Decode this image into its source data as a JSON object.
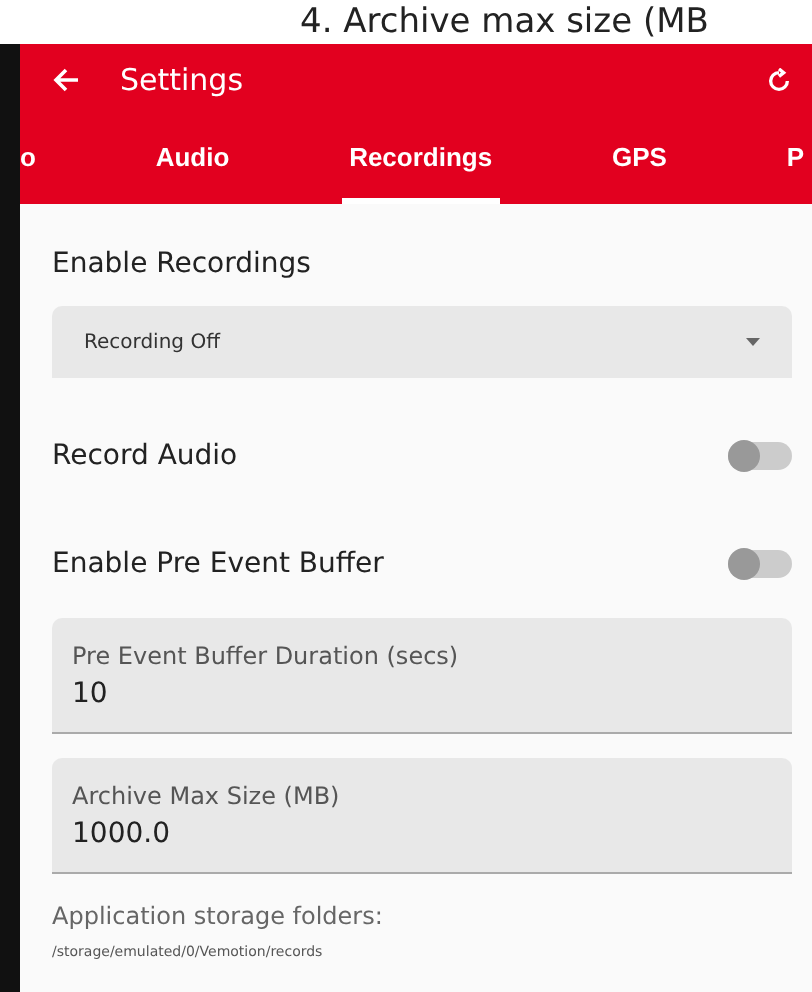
{
  "caption": "4.  Archive max size (MB",
  "app_bar": {
    "title": "Settings"
  },
  "tabs": [
    {
      "label": "o",
      "selected": false
    },
    {
      "label": "Audio",
      "selected": false
    },
    {
      "label": "Recordings",
      "selected": true
    },
    {
      "label": "GPS",
      "selected": false
    },
    {
      "label": "P",
      "selected": false
    }
  ],
  "settings": [
    {
      "kind": "header",
      "label": "Enable Recordings"
    },
    {
      "kind": "dropdown",
      "value": "Recording Off"
    },
    {
      "kind": "switch",
      "label": "Record Audio",
      "on": false
    },
    {
      "kind": "switch",
      "label": "Enable Pre Event Buffer",
      "on": false
    },
    {
      "kind": "field",
      "label": "Pre Event Buffer Duration (secs)",
      "value": "10"
    },
    {
      "kind": "field",
      "label": "Archive Max Size (MB)",
      "value": "1000.0"
    },
    {
      "kind": "info",
      "label": "Application storage folders:",
      "value": "/storage/emulated/0/Vemotion/records"
    }
  ]
}
